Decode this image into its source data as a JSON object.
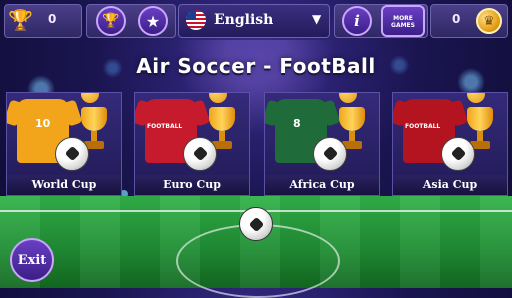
{
  "top_bar": {
    "trophy_count": "0",
    "coin_count": "0",
    "language": "English",
    "more_games_label": "MORE GAMES"
  },
  "title": "Air Soccer - FootBall",
  "cups": [
    {
      "label": "World Cup",
      "shirt_color": "#f2a51a",
      "shirt_number": "10"
    },
    {
      "label": "Euro Cup",
      "shirt_color": "#c61b2c",
      "shirt_number": "FOOTBALL"
    },
    {
      "label": "Africa Cup",
      "shirt_color": "#1f6b3a",
      "shirt_number": "8"
    },
    {
      "label": "Asia Cup",
      "shirt_color": "#b3141f",
      "shirt_number": "FOOTBALL"
    }
  ],
  "exit_label": "Exit",
  "colors": {
    "accent": "#6a3fc4",
    "gold": "#f0a51a",
    "pitch": "#2aa63e"
  }
}
